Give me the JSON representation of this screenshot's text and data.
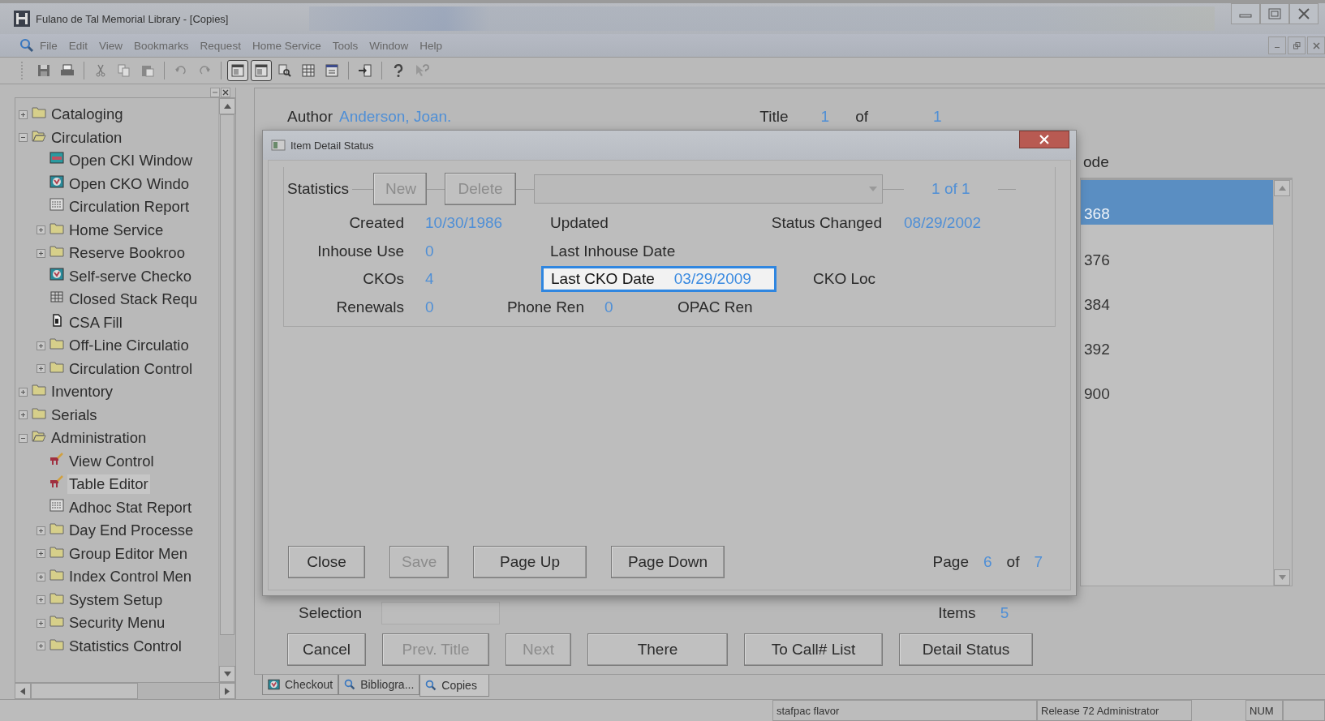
{
  "window": {
    "title": "Fulano de Tal Memorial Library - [Copies]"
  },
  "menu": [
    "File",
    "Edit",
    "View",
    "Bookmarks",
    "Request",
    "Home Service",
    "Tools",
    "Window",
    "Help"
  ],
  "toolbar": [
    {
      "kind": "save",
      "pressed": false
    },
    {
      "kind": "print",
      "pressed": false
    },
    {
      "kind": "separator"
    },
    {
      "kind": "cut",
      "pressed": false
    },
    {
      "kind": "copy",
      "pressed": false
    },
    {
      "kind": "paste",
      "pressed": false
    },
    {
      "kind": "separator"
    },
    {
      "kind": "undo",
      "pressed": false
    },
    {
      "kind": "redo",
      "pressed": false
    },
    {
      "kind": "separator"
    },
    {
      "kind": "panel",
      "pressed": true
    },
    {
      "kind": "panel",
      "pressed": true
    },
    {
      "kind": "find",
      "pressed": false
    },
    {
      "kind": "table",
      "pressed": false
    },
    {
      "kind": "form",
      "pressed": false
    },
    {
      "kind": "separator"
    },
    {
      "kind": "exit",
      "pressed": false
    },
    {
      "kind": "separator"
    },
    {
      "kind": "help",
      "pressed": false
    },
    {
      "kind": "whatsthis",
      "pressed": false
    }
  ],
  "tree": [
    {
      "label": "Cataloging",
      "kind": "folder",
      "expanded": false,
      "selected": false
    },
    {
      "label": "Circulation",
      "kind": "folder",
      "expanded": true,
      "selected": false,
      "children": [
        {
          "label": "Open CKI Window",
          "kind": "screen",
          "selected": false
        },
        {
          "label": "Open CKO Windo",
          "kind": "globe",
          "selected": false
        },
        {
          "label": "Circulation Report",
          "kind": "report",
          "selected": false
        },
        {
          "label": "Home Service",
          "kind": "folder",
          "expanded": false,
          "selected": false
        },
        {
          "label": "Reserve Bookroo",
          "kind": "folder",
          "expanded": false,
          "selected": false
        },
        {
          "label": "Self-serve Checko",
          "kind": "globe",
          "selected": false
        },
        {
          "label": "Closed Stack Requ",
          "kind": "grid",
          "selected": false
        },
        {
          "label": "CSA Fill",
          "kind": "doc",
          "selected": false
        },
        {
          "label": "Off-Line Circulatio",
          "kind": "folder",
          "expanded": false,
          "selected": false
        },
        {
          "label": "Circulation Control",
          "kind": "folder",
          "expanded": false,
          "selected": false
        }
      ]
    },
    {
      "label": "Inventory",
      "kind": "folder",
      "expanded": false,
      "selected": false
    },
    {
      "label": "Serials",
      "kind": "folder",
      "expanded": false,
      "selected": false
    },
    {
      "label": "Administration",
      "kind": "folder",
      "expanded": true,
      "selected": false,
      "children": [
        {
          "label": "View Control",
          "kind": "tool",
          "selected": false
        },
        {
          "label": "Table Editor",
          "kind": "tool",
          "selected": true
        },
        {
          "label": "Adhoc Stat Report",
          "kind": "report",
          "selected": false
        },
        {
          "label": "Day End Processe",
          "kind": "folder",
          "expanded": false,
          "selected": false
        },
        {
          "label": "Group Editor Men",
          "kind": "folder",
          "expanded": false,
          "selected": false
        },
        {
          "label": "Index Control Men",
          "kind": "folder",
          "expanded": false,
          "selected": false
        },
        {
          "label": "System Setup",
          "kind": "folder",
          "expanded": false,
          "selected": false
        },
        {
          "label": "Security Menu",
          "kind": "folder",
          "expanded": false,
          "selected": false
        },
        {
          "label": "Statistics Control",
          "kind": "folder",
          "expanded": false,
          "selected": false
        }
      ]
    }
  ],
  "record": {
    "author_label": "Author",
    "author": "Anderson, Joan.",
    "title_label": "Title",
    "title_index": "1",
    "of_label": "of",
    "title_total": "1"
  },
  "barcodes": {
    "header": "ode",
    "rows": [
      {
        "text": "368",
        "selected": true
      },
      {
        "text": "376",
        "selected": false
      },
      {
        "text": "384",
        "selected": false
      },
      {
        "text": "392",
        "selected": false
      },
      {
        "text": "900",
        "selected": false
      }
    ]
  },
  "selection": {
    "label": "Selection",
    "items_label": "Items",
    "items": "5"
  },
  "buttons": [
    {
      "label": "Cancel",
      "disabled": false
    },
    {
      "label": "Prev. Title",
      "disabled": true
    },
    {
      "label": "Next",
      "disabled": true
    },
    {
      "label": "There",
      "disabled": false
    },
    {
      "label": "To Call# List",
      "disabled": false
    },
    {
      "label": "Detail Status",
      "disabled": false
    }
  ],
  "tabs": [
    {
      "label": "Checkout",
      "kind": "globe",
      "selected": false
    },
    {
      "label": "Bibliogra...",
      "kind": "search",
      "selected": false
    },
    {
      "label": "Copies",
      "kind": "search",
      "selected": true
    }
  ],
  "status_bar": [
    "stafpac flavor",
    "Release 72 Administrator",
    "NUM"
  ],
  "dialog": {
    "title": "Item Detail Status",
    "group": "Statistics",
    "actions": [
      {
        "label": "New",
        "disabled": true
      },
      {
        "label": "Delete",
        "disabled": true
      }
    ],
    "counter": "1 of 1",
    "lines": [
      {
        "fields": [
          {
            "label": "Created",
            "value": "10/30/1986",
            "focused": false
          },
          {
            "label": "Updated",
            "focused": false
          },
          {
            "label": "Status Changed",
            "value": "08/29/2002",
            "focused": false
          }
        ]
      },
      {
        "fields": [
          {
            "label": "Inhouse Use",
            "value": "0",
            "focused": false
          },
          {
            "label": "Last Inhouse Date",
            "focused": false
          }
        ]
      },
      {
        "fields": [
          {
            "label": "CKOs",
            "value": "4",
            "focused": false
          },
          {
            "label": "Last CKO Date",
            "value": "03/29/2009",
            "focused": true
          },
          {
            "label": "CKO Loc",
            "focused": false
          }
        ]
      },
      {
        "fields": [
          {
            "label": "Renewals",
            "value": "0",
            "focused": false
          },
          {
            "label": "Phone Ren",
            "value": "0",
            "focused": false
          },
          {
            "label": "OPAC Ren",
            "focused": false
          }
        ]
      }
    ],
    "buttons": [
      {
        "label": "Close",
        "disabled": false
      },
      {
        "label": "Save",
        "disabled": true
      },
      {
        "label": "Page Up",
        "disabled": false
      },
      {
        "label": "Page Down",
        "disabled": false
      }
    ],
    "page": {
      "label": "Page",
      "current": "6",
      "of_label": "of",
      "total": "7"
    }
  }
}
